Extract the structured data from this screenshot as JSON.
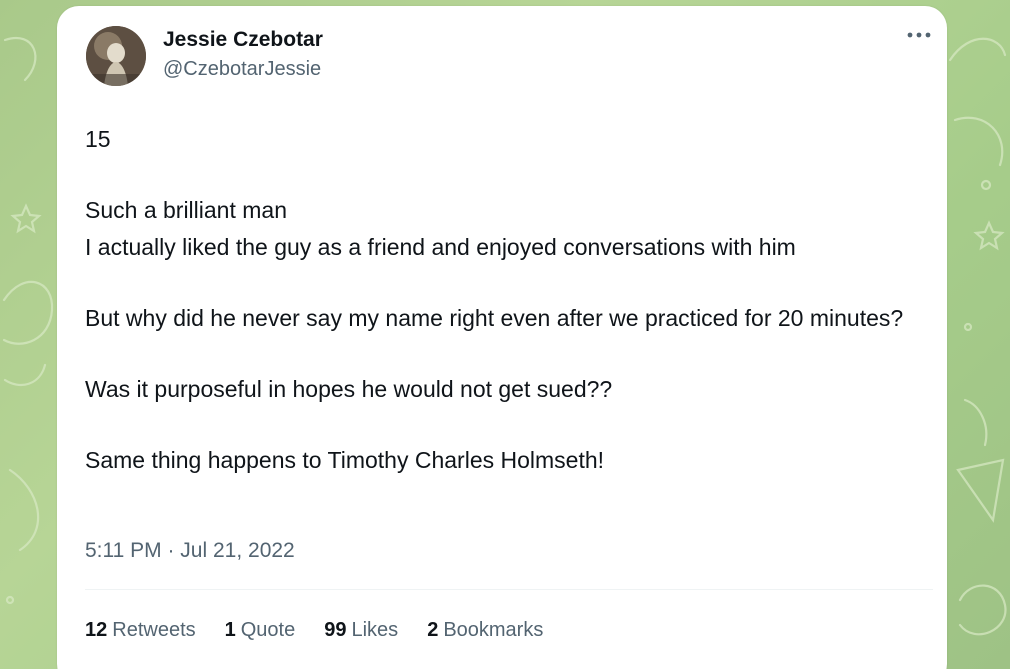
{
  "author": {
    "name": "Jessie Czebotar",
    "handle": "@CzebotarJessie"
  },
  "menu_icon": "more-horizontal-icon",
  "tweet": {
    "lines": [
      "15",
      "Such a brilliant man",
      "I actually liked the guy as a friend and enjoyed conversations with him",
      "But why did he never say my name right even after we practiced for 20 minutes?",
      "Was it purposeful in hopes he would not get sued??",
      "Same thing happens to Timothy Charles Holmseth!"
    ],
    "timestamp": "5:11 PM · Jul 21, 2022"
  },
  "stats": [
    {
      "count": "12",
      "label": "Retweets"
    },
    {
      "count": "1",
      "label": "Quote"
    },
    {
      "count": "99",
      "label": "Likes"
    },
    {
      "count": "2",
      "label": "Bookmarks"
    }
  ],
  "colors": {
    "background": "#b0d193",
    "card": "#ffffff",
    "text": "#0f1419",
    "secondary": "#536471"
  }
}
